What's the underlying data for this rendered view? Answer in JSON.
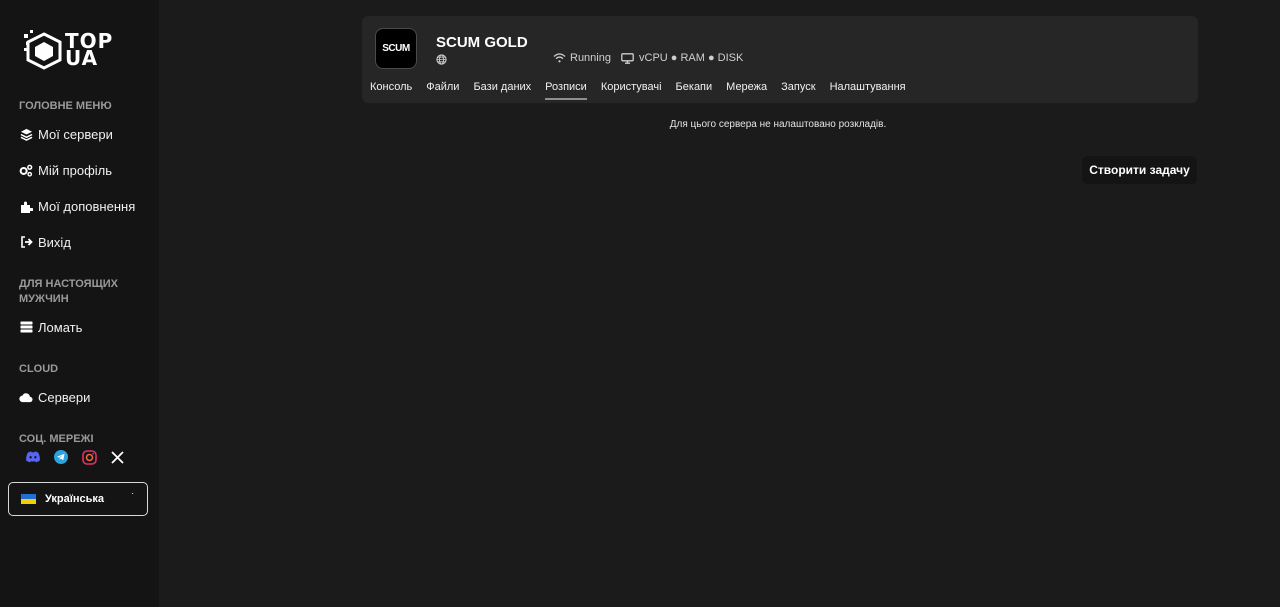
{
  "brand": {
    "logo_text_line1": "TOP",
    "logo_text_line2": "UA"
  },
  "sidebar": {
    "main_menu_title": "ГОЛОВНЕ МЕНЮ",
    "main_menu": [
      {
        "label": "Мої сервери",
        "icon": "layers-icon"
      },
      {
        "label": "Мій профіль",
        "icon": "gears-icon"
      },
      {
        "label": "Мої доповнення",
        "icon": "puzzle-icon"
      },
      {
        "label": "Вихід",
        "icon": "logout-icon"
      }
    ],
    "men_section_title": "ДЛЯ НАСТОЯЩИХ МУЖЧИН",
    "men_items": [
      {
        "label": "Ломать",
        "icon": "server-stack-icon"
      }
    ],
    "cloud_section_title": "CLOUD",
    "cloud_items": [
      {
        "label": "Сервери",
        "icon": "cloud-icon"
      }
    ],
    "social_title": "СОЦ. МЕРЕЖІ",
    "social_icons": [
      "discord-icon",
      "telegram-icon",
      "instagram-icon",
      "x-icon"
    ],
    "language": {
      "label": "Українська",
      "caret": "˙"
    }
  },
  "server": {
    "logo_text": "SCUM",
    "name": "SCUM GOLD",
    "status": "Running",
    "resources": "vCPU ● RAM ● DISK",
    "tabs": [
      "Консоль",
      "Файли",
      "Бази даних",
      "Розписи",
      "Користувачі",
      "Бекапи",
      "Мережа",
      "Запуск",
      "Налаштування"
    ],
    "active_tab": "Розписи"
  },
  "schedules": {
    "empty_message": "Для цього сервера не налаштовано розкладів.",
    "create_button": "Створити задачу"
  },
  "colors": {
    "background": "#1b1b1b",
    "sidebar": "#141414",
    "card": "#262626",
    "discord": "#5865f2",
    "telegram": "#2aa3e0",
    "instagram": "#e1306c"
  }
}
